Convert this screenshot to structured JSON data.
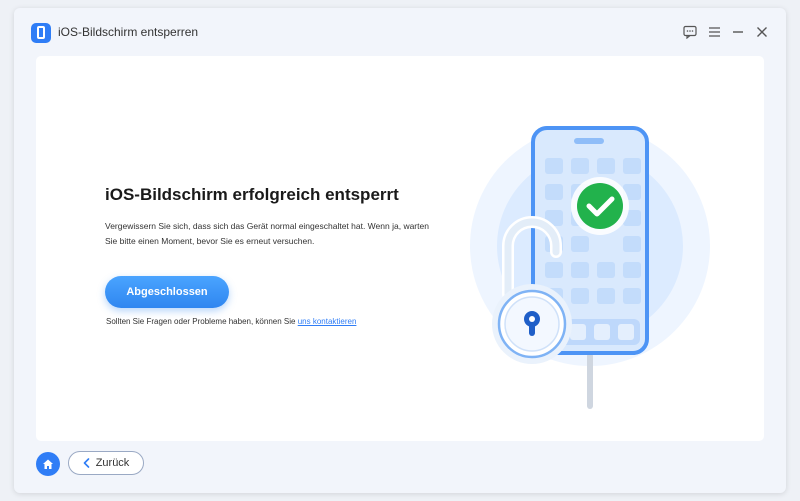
{
  "window": {
    "title": "iOS-Bildschirm entsperren",
    "controls": [
      "feedback-icon",
      "menu-icon",
      "minimize-icon",
      "close-icon"
    ]
  },
  "main": {
    "headline": "iOS-Bildschirm erfolgreich entsperrt",
    "description": "Vergewissern Sie sich, dass sich das Gerät normal eingeschaltet hat. Wenn ja, warten Sie bitte einen Moment, bevor Sie es erneut versuchen.",
    "done_button": "Abgeschlossen",
    "help_text": "Sollten Sie Fragen oder Probleme haben, können Sie",
    "help_link": "uns kontaktieren"
  },
  "footer": {
    "back_button": "Zurück"
  },
  "colors": {
    "accent": "#2f7df6",
    "success": "#22b24c",
    "background": "#eef1f6"
  }
}
